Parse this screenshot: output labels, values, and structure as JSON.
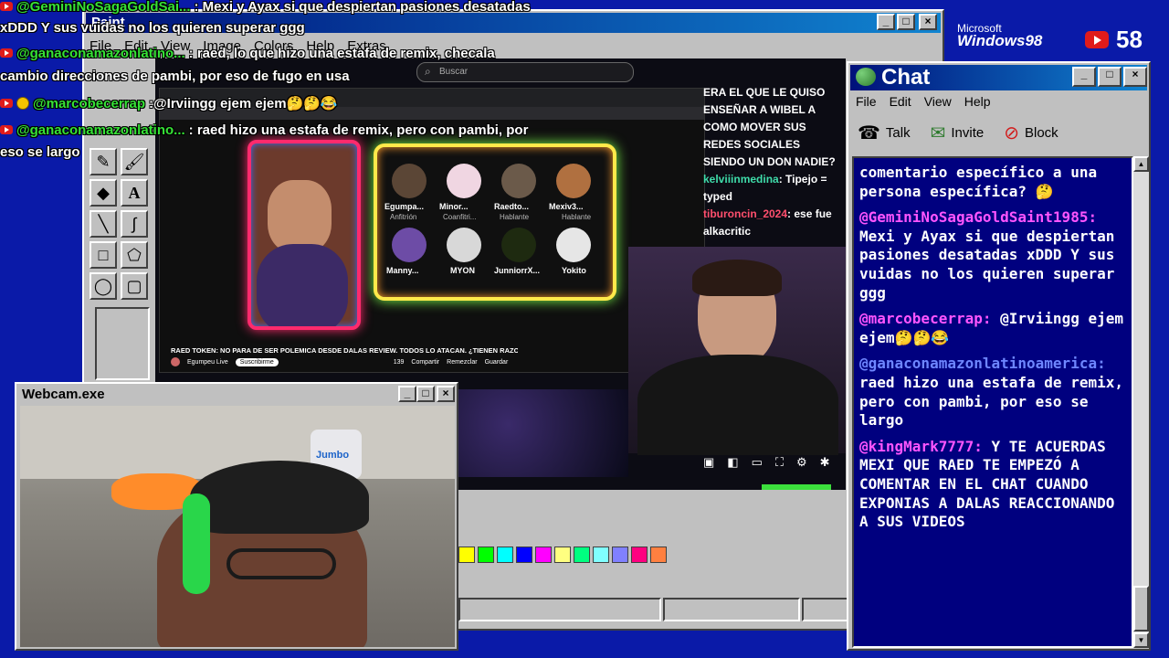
{
  "overlay_chat": [
    {
      "user": "@GeminiNoSagaGoldSai...",
      "text": ": Mexi y Ayax si que despiertan pasiones desatadas"
    },
    {
      "user": "",
      "text": "xDDD Y sus vuidas no los quieren superar ggg"
    },
    {
      "user": "@ganaconamazonlatino...",
      "text": ": raed, lo que hizo una estafa de remix, checala"
    },
    {
      "user": "",
      "text": "cambio direcciones de pambi, por eso de fugo en usa"
    },
    {
      "user": "@marcobecerrap",
      "text": ":@Irviingg ejem ejem🤔🤔😂"
    },
    {
      "user": "@ganaconamazonlatino...",
      "text": ": raed hizo una estafa de remix, pero con pambi, por"
    },
    {
      "user": "",
      "text": "eso se largo"
    }
  ],
  "paint": {
    "title": "Paint",
    "menu": [
      "File",
      "Edit",
      "View",
      "Image",
      "Colors",
      "Help",
      "Extras"
    ]
  },
  "branding": {
    "line1": "Microsoft",
    "line2": "Windows98",
    "counter": "58"
  },
  "browser": {
    "search_placeholder": "Buscar",
    "video_title": "RAED TOKEN: NO PARA DE SER POLEMICA DESDE DALAS REVIEW. TODOS LO ATACAN. ¿TIENEN RAZON?",
    "channel": "Egumpeu Live",
    "subscribe": "Suscribirme",
    "likes": "139",
    "share": "Compartir",
    "remix": "Remezclar",
    "save": "Guardar",
    "participants": [
      {
        "name": "Egumpa...",
        "role": "Anfitrión"
      },
      {
        "name": "Minor...",
        "role": "Coanfitri..."
      },
      {
        "name": "Raedto...",
        "role": "Hablante"
      },
      {
        "name": "Mexiv3...",
        "role": "Hablante"
      },
      {
        "name": "Manny...",
        "role": ""
      },
      {
        "name": "MYON",
        "role": ""
      },
      {
        "name": "JunniorrX...",
        "role": ""
      },
      {
        "name": "Yokito",
        "role": ""
      }
    ]
  },
  "side_chat": [
    {
      "user": "",
      "text": "ERA EL QUE LE QUISO ENSEÑAR A WIBEL A COMO MOVER SUS REDES SOCIALES SIENDO UN DON NADIE?"
    },
    {
      "user": "kelviiinmedina",
      "text": ": Tipejo = typed"
    },
    {
      "user": "tiburoncin_2024",
      "text": ": ese fue alkacritic"
    }
  ],
  "webcam": {
    "title": "Webcam.exe",
    "product_label": "Jumbo"
  },
  "chat_window": {
    "title": "Chat",
    "menu": [
      "File",
      "Edit",
      "View",
      "Help"
    ],
    "toolbar": {
      "talk": "Talk",
      "invite": "Invite",
      "block": "Block"
    },
    "messages": [
      {
        "user": "",
        "text": "comentario específico a una persona específica? 🤔"
      },
      {
        "user": "@GeminiNoSagaGoldSaint1985:",
        "text": " Mexi y Ayax si que despiertan pasiones desatadas xDDD Y sus vuidas no los quieren superar ggg"
      },
      {
        "user": "@marcobecerrap:",
        "text": " @Irviingg ejem ejem🤔🤔😂"
      },
      {
        "user": "@ganaconamazonlatinoamerica:",
        "text": " raed hizo una estafa de remix, pero con pambi, por eso se largo"
      },
      {
        "user": "@kingMark7777:",
        "text": " Y TE ACUERDAS MEXI QUE RAED TE EMPEZÓ A COMENTAR EN EL CHAT CUANDO EXPONIAS A DALAS REACCIONANDO A SUS VIDEOS"
      }
    ]
  },
  "colors": {
    "desktop": "#0a1aa8",
    "chat_bg": "#00007f",
    "username": "#ff55ff",
    "overlay_user": "#36e236"
  }
}
